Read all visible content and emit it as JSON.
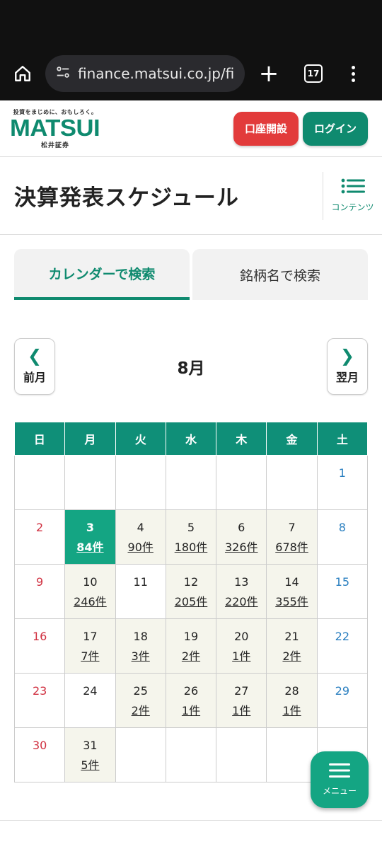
{
  "browser": {
    "url": "finance.matsui.co.jp/find",
    "tab_count": "17"
  },
  "header": {
    "logo_tagline": "投資をまじめに、おもしろく。",
    "logo_main": "MATSUI",
    "logo_sub": "松井証券",
    "open_account_label": "口座開設",
    "login_label": "ログイン",
    "accent": "#0f8a6f",
    "red": "#e23b3b"
  },
  "page": {
    "title": "決算発表スケジュール",
    "contents_label": "コンテンツ"
  },
  "search_tabs": {
    "calendar_label": "カレンダーで検索",
    "name_label": "銘柄名で検索"
  },
  "month_nav": {
    "prev_chevron": "❮",
    "prev_label": "前月",
    "month": "8月",
    "next_chevron": "❯",
    "next_label": "翌月"
  },
  "calendar": {
    "weekdays": [
      "日",
      "月",
      "火",
      "水",
      "木",
      "金",
      "土"
    ],
    "weeks": [
      [
        {
          "day": ""
        },
        {
          "day": ""
        },
        {
          "day": ""
        },
        {
          "day": ""
        },
        {
          "day": ""
        },
        {
          "day": ""
        },
        {
          "day": "1"
        }
      ],
      [
        {
          "day": "2"
        },
        {
          "day": "3",
          "count": "84件"
        },
        {
          "day": "4",
          "count": "90件"
        },
        {
          "day": "5",
          "count": "180件"
        },
        {
          "day": "6",
          "count": "326件"
        },
        {
          "day": "7",
          "count": "678件"
        },
        {
          "day": "8"
        }
      ],
      [
        {
          "day": "9"
        },
        {
          "day": "10",
          "count": "246件"
        },
        {
          "day": "11"
        },
        {
          "day": "12",
          "count": "205件"
        },
        {
          "day": "13",
          "count": "220件"
        },
        {
          "day": "14",
          "count": "355件"
        },
        {
          "day": "15"
        }
      ],
      [
        {
          "day": "16"
        },
        {
          "day": "17",
          "count": "7件"
        },
        {
          "day": "18",
          "count": "3件"
        },
        {
          "day": "19",
          "count": "2件"
        },
        {
          "day": "20",
          "count": "1件"
        },
        {
          "day": "21",
          "count": "2件"
        },
        {
          "day": "22"
        }
      ],
      [
        {
          "day": "23"
        },
        {
          "day": "24"
        },
        {
          "day": "25",
          "count": "2件"
        },
        {
          "day": "26",
          "count": "1件"
        },
        {
          "day": "27",
          "count": "1件"
        },
        {
          "day": "28",
          "count": "1件"
        },
        {
          "day": "29"
        }
      ],
      [
        {
          "day": "30"
        },
        {
          "day": "31",
          "count": "5件"
        },
        {
          "day": ""
        },
        {
          "day": ""
        },
        {
          "day": ""
        },
        {
          "day": ""
        },
        {
          "day": ""
        }
      ]
    ],
    "selected_day": "3"
  },
  "fab": {
    "label": "メニュー"
  }
}
